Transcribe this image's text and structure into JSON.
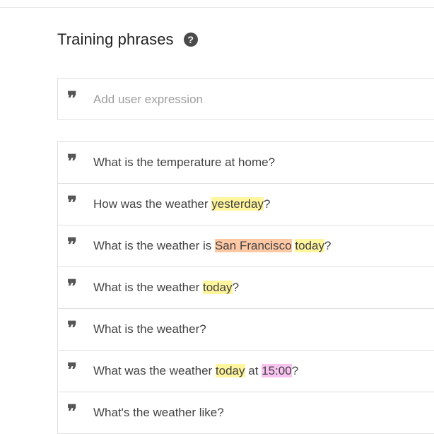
{
  "section": {
    "title": "Training phrases",
    "help_icon": "question-mark-circle-icon",
    "help_glyph": "?"
  },
  "add_expression": {
    "placeholder": "Add user expression",
    "value": ""
  },
  "quote_icon": "quote-icon",
  "quote_glyph": "❞",
  "highlight_colors": {
    "yellow": "#fff59d",
    "orange": "#ffc8a4",
    "pink": "#f8c3f0"
  },
  "phrases": [
    {
      "segments": [
        {
          "text": "What is the temperature at home?"
        }
      ]
    },
    {
      "segments": [
        {
          "text": "How was the weather "
        },
        {
          "text": "yesterday",
          "hl": "yellow"
        },
        {
          "text": "?"
        }
      ]
    },
    {
      "segments": [
        {
          "text": "What is the weather is "
        },
        {
          "text": "San Francisco",
          "hl": "orange"
        },
        {
          "text": " "
        },
        {
          "text": "today",
          "hl": "yellow"
        },
        {
          "text": "?"
        }
      ]
    },
    {
      "segments": [
        {
          "text": "What is the weather "
        },
        {
          "text": "today",
          "hl": "yellow"
        },
        {
          "text": "?"
        }
      ]
    },
    {
      "segments": [
        {
          "text": "What is the weather?"
        }
      ]
    },
    {
      "segments": [
        {
          "text": "What was the weather "
        },
        {
          "text": "today",
          "hl": "yellow"
        },
        {
          "text": " at "
        },
        {
          "text": "15:00",
          "hl": "pink"
        },
        {
          "text": "?"
        }
      ]
    },
    {
      "segments": [
        {
          "text": "What's the weather like?"
        }
      ]
    }
  ]
}
